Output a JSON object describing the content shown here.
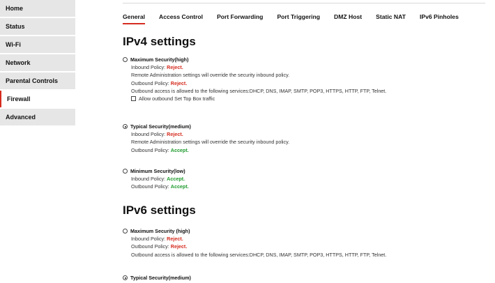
{
  "sidebar": {
    "items": [
      {
        "label": "Home"
      },
      {
        "label": "Status"
      },
      {
        "label": "Wi-Fi"
      },
      {
        "label": "Network"
      },
      {
        "label": "Parental Controls"
      },
      {
        "label": "Firewall"
      },
      {
        "label": "Advanced"
      }
    ]
  },
  "tabs": [
    {
      "label": "General"
    },
    {
      "label": "Access Control"
    },
    {
      "label": "Port Forwarding"
    },
    {
      "label": "Port Triggering"
    },
    {
      "label": "DMZ Host"
    },
    {
      "label": "Static NAT"
    },
    {
      "label": "IPv6 Pinholes"
    }
  ],
  "ipv4": {
    "heading": "IPv4 settings",
    "max": {
      "title": "Maximum Security(high)",
      "inbound_prefix": "Inbound Policy: ",
      "inbound_value": "Reject.",
      "remote_note": "Remote Administration settings will override the security inbound policy.",
      "outbound_prefix": "Outbound Policy: ",
      "outbound_value": "Reject.",
      "outbound_note": "Outbound access is allowed to the following services:DHCP, DNS, IMAP, SMTP, POP3, HTTPS, HTTP, FTP, Telnet.",
      "checkbox_label": "Allow outbound Set Top Box traffic"
    },
    "typical": {
      "title": "Typical Security(medium)",
      "inbound_prefix": "Inbound Policy: ",
      "inbound_value": "Reject.",
      "remote_note": "Remote Administration settings will override the security inbound policy.",
      "outbound_prefix": "Outbound Policy: ",
      "outbound_value": "Accept."
    },
    "min": {
      "title": "Minimum Security(low)",
      "inbound_prefix": "Inbound Policy: ",
      "inbound_value": "Accept.",
      "outbound_prefix": "Outbound Policy: ",
      "outbound_value": "Accept."
    }
  },
  "ipv6": {
    "heading": "IPv6 settings",
    "max": {
      "title": "Maximum Security (high)",
      "inbound_prefix": "Inbound Policy: ",
      "inbound_value": "Reject.",
      "outbound_prefix": "Outbound Policy: ",
      "outbound_value": "Reject.",
      "outbound_note": "Outbound access is allowed to the following services:DHCP, DNS, IMAP, SMTP, POP3, HTTPS, HTTP, FTP, Telnet."
    },
    "typical": {
      "title": "Typical Security(medium)"
    }
  }
}
